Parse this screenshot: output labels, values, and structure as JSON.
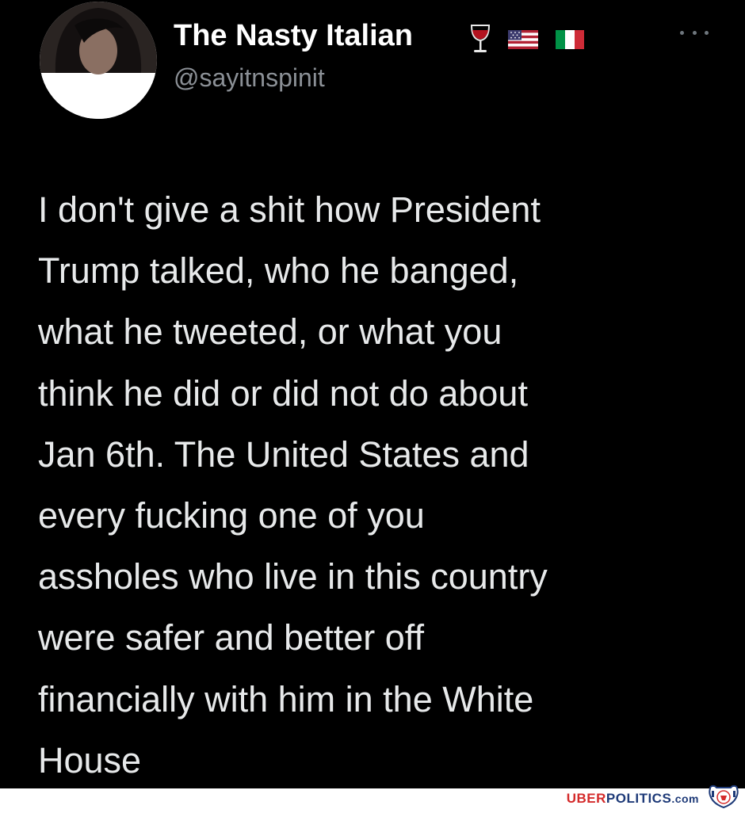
{
  "tweet": {
    "display_name": "The Nasty Italian",
    "handle": "@sayitnspinit",
    "name_emojis": [
      "wine-glass-icon",
      "us-flag-icon",
      "italy-flag-icon"
    ],
    "text_lines": [
      "I don't give a shit how President",
      "Trump talked, who he banged,",
      "what he tweeted, or what you",
      "think he did or did not do about",
      "Jan 6th. The United States and",
      "every fucking one of you",
      "assholes who live in this country",
      "were safer and better off",
      "financially with him in the White",
      "House"
    ]
  },
  "watermark": {
    "uber": "UBER",
    "politics": "POLITICS",
    "com": ".com"
  },
  "colors": {
    "background": "#000000",
    "text": "#e7e9ea",
    "handle": "#8b9096",
    "watermark_red": "#d42a2a",
    "watermark_blue": "#1e3a78"
  }
}
